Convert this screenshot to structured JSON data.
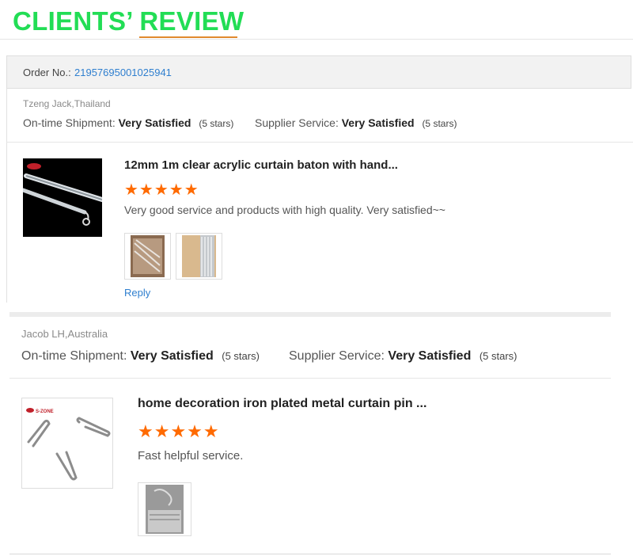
{
  "heading": "CLIENTS’ REVIEW",
  "reviews": [
    {
      "order_label": "Order No.:",
      "order_number": "21957695001025941",
      "reviewer": "Tzeng Jack,Thailand",
      "shipment_label": "On-time Shipment:",
      "shipment_value": "Very Satisfied",
      "shipment_stars": "(5 stars)",
      "supplier_label": "Supplier Service:",
      "supplier_value": "Very Satisfied",
      "supplier_stars": "(5 stars)",
      "product_title": "12mm 1m clear acrylic curtain baton with hand...",
      "stars": "★★★★★",
      "comment": "Very good service and products with high quality. Very satisfied~~",
      "reply": "Reply"
    },
    {
      "reviewer": "Jacob LH,Australia",
      "shipment_label": "On-time Shipment:",
      "shipment_value": "Very Satisfied",
      "shipment_stars": "(5 stars)",
      "supplier_label": "Supplier Service:",
      "supplier_value": "Very Satisfied",
      "supplier_stars": "(5 stars)",
      "product_title": "home decoration iron plated metal curtain pin ...",
      "stars": "★★★★★",
      "comment": "Fast helpful service.",
      "logo_text": "S-ZONE"
    }
  ],
  "colors": {
    "heading": "#22dd55",
    "link": "#2f7fcf",
    "star": "#ff6a00"
  }
}
